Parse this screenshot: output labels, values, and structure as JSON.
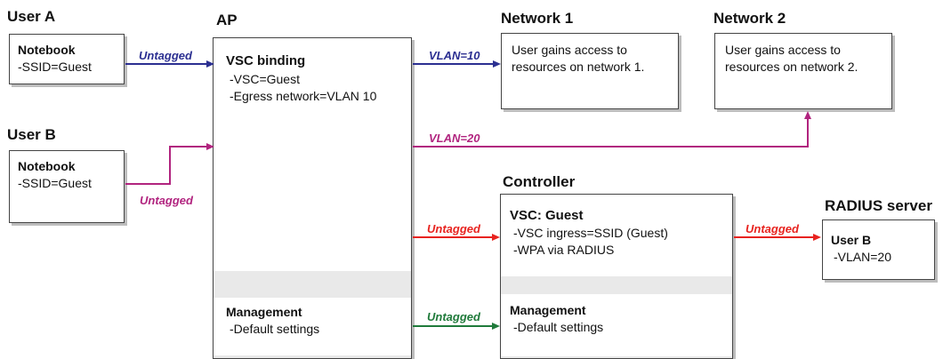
{
  "colors": {
    "untagged_a": "#2b2f91",
    "vlan10": "#2b2f91",
    "magenta": "#b1247f",
    "red": "#e8231f",
    "green": "#1f7a3a"
  },
  "user_a": {
    "title": "User A",
    "device": "Notebook",
    "ssid": "-SSID=Guest"
  },
  "user_b": {
    "title": "User B",
    "device": "Notebook",
    "ssid": "-SSID=Guest"
  },
  "ap": {
    "title": "AP",
    "vsc_heading": "VSC binding",
    "vsc_line1": "-VSC=Guest",
    "vsc_line2": "-Egress network=VLAN 10",
    "mgmt_heading": "Management",
    "mgmt_line1": "-Default settings"
  },
  "network1": {
    "title": "Network 1",
    "line1": "User gains access to",
    "line2": "resources on network 1."
  },
  "network2": {
    "title": "Network 2",
    "line1": "User gains access to",
    "line2": "resources on network 2."
  },
  "controller": {
    "title": "Controller",
    "vsc_heading": "VSC: Guest",
    "vsc_line1": "-VSC ingress=SSID (Guest)",
    "vsc_line2": "-WPA via RADIUS",
    "mgmt_heading": "Management",
    "mgmt_line1": "-Default settings"
  },
  "radius": {
    "title": "RADIUS server",
    "user": "User B",
    "vlan": "-VLAN=20"
  },
  "links": {
    "user_a_to_ap": "Untagged",
    "user_b_to_ap": "Untagged",
    "ap_to_net1": "VLAN=10",
    "ap_to_net2": "VLAN=20",
    "ap_to_controller": "Untagged",
    "ap_mgmt_to_controller": "Untagged",
    "controller_to_radius": "Untagged"
  }
}
